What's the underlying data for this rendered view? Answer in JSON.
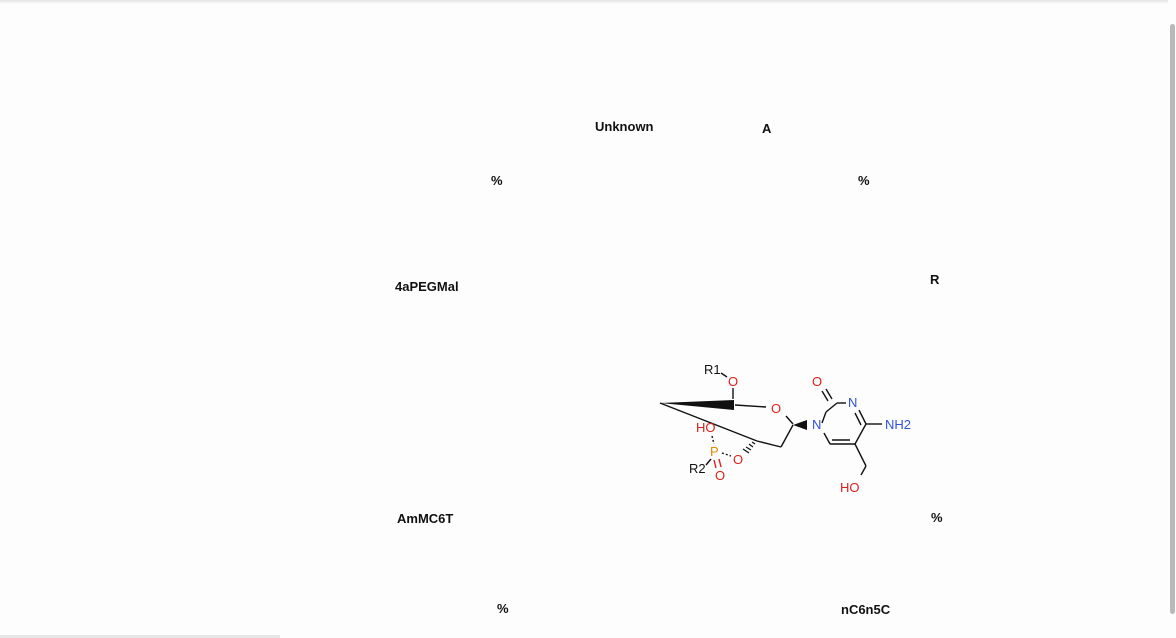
{
  "labels": {
    "unknown": "Unknown",
    "a": "A",
    "pct_left_top": "%",
    "pct_right_top": "%",
    "pegmal": "4aPEGMal",
    "r": "R",
    "ammc6t": "AmMC6T",
    "pct_right_mid": "%",
    "pct_left_bottom": "%",
    "nc6n5c": "nC6n5C"
  },
  "molecule": {
    "atoms": {
      "r1": "R1",
      "o_top": "O",
      "o_ring": "O",
      "o_carbonyl": "O",
      "n3": "N",
      "n1": "N",
      "nh2": "NH2",
      "ho_phos": "HO",
      "p": "P",
      "o_link": "O",
      "r2": "R2",
      "o_double": "O",
      "ho_bottom": "HO"
    },
    "colors": {
      "oxygen": "#e0201b",
      "nitrogen": "#3050d8",
      "phosphorus": "#e08a00",
      "carbon": "#111111"
    }
  }
}
